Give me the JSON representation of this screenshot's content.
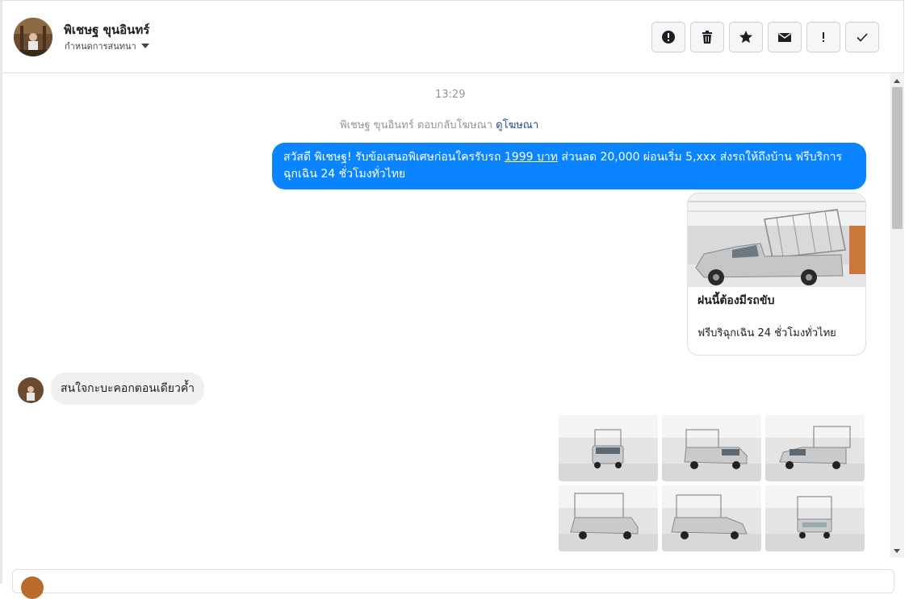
{
  "header": {
    "contact_name": "พิเชษฐ ขุนอินทร์",
    "assign_label": "กำหนดการสนทนา",
    "toolbar": [
      {
        "name": "spam-button",
        "icon": "alert-circle-icon"
      },
      {
        "name": "delete-button",
        "icon": "trash-icon"
      },
      {
        "name": "star-button",
        "icon": "star-icon"
      },
      {
        "name": "mark-unread-button",
        "icon": "envelope-icon"
      },
      {
        "name": "follow-up-button",
        "icon": "exclamation-icon"
      },
      {
        "name": "mark-done-button",
        "icon": "check-icon"
      }
    ]
  },
  "thread": {
    "timestamp": "13:29",
    "ad_reply": {
      "text": "พิเชษฐ ขุนอินทร์ ตอบกลับโฆษณา",
      "link": "ดูโฆษณา"
    },
    "outgoing": {
      "before_link": "สวัสดี พิเชษฐ! รับข้อเสนอพิเศษก่อนใครรับรถ ",
      "link": "1999 บาท",
      "after_link": " ส่วนลด 20,000  ผ่อนเริ่ม 5,xxx ส่งรถให้ถึงบ้าน ฟรีบริการฉุกเฉิน 24 ชั่วโมงทั่วไทย"
    },
    "ad_card": {
      "title": "ฝนนี้ต้องมีรถขับ",
      "description": "ฟรีบริฉุกเฉิน 24 ชั่วโมงทั่วไทย"
    },
    "incoming": {
      "text": "สนใจกะบะคอกตอนเดียวค้ำ"
    }
  },
  "colors": {
    "outgoing_bubble": "#0a84ff",
    "incoming_bubble": "#f1f0f0",
    "link": "#1c4f8e"
  }
}
